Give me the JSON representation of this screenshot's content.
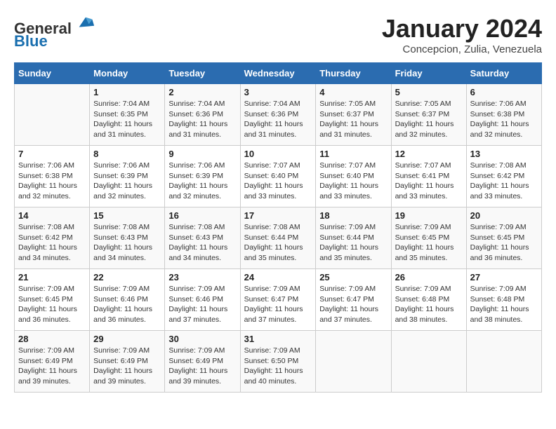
{
  "header": {
    "logo_general": "General",
    "logo_blue": "Blue",
    "month": "January 2024",
    "location": "Concepcion, Zulia, Venezuela"
  },
  "days_of_week": [
    "Sunday",
    "Monday",
    "Tuesday",
    "Wednesday",
    "Thursday",
    "Friday",
    "Saturday"
  ],
  "weeks": [
    [
      {
        "day": "",
        "sunrise": "",
        "sunset": "",
        "daylight": ""
      },
      {
        "day": "1",
        "sunrise": "Sunrise: 7:04 AM",
        "sunset": "Sunset: 6:35 PM",
        "daylight": "Daylight: 11 hours and 31 minutes."
      },
      {
        "day": "2",
        "sunrise": "Sunrise: 7:04 AM",
        "sunset": "Sunset: 6:36 PM",
        "daylight": "Daylight: 11 hours and 31 minutes."
      },
      {
        "day": "3",
        "sunrise": "Sunrise: 7:04 AM",
        "sunset": "Sunset: 6:36 PM",
        "daylight": "Daylight: 11 hours and 31 minutes."
      },
      {
        "day": "4",
        "sunrise": "Sunrise: 7:05 AM",
        "sunset": "Sunset: 6:37 PM",
        "daylight": "Daylight: 11 hours and 31 minutes."
      },
      {
        "day": "5",
        "sunrise": "Sunrise: 7:05 AM",
        "sunset": "Sunset: 6:37 PM",
        "daylight": "Daylight: 11 hours and 32 minutes."
      },
      {
        "day": "6",
        "sunrise": "Sunrise: 7:06 AM",
        "sunset": "Sunset: 6:38 PM",
        "daylight": "Daylight: 11 hours and 32 minutes."
      }
    ],
    [
      {
        "day": "7",
        "sunrise": "Sunrise: 7:06 AM",
        "sunset": "Sunset: 6:38 PM",
        "daylight": "Daylight: 11 hours and 32 minutes."
      },
      {
        "day": "8",
        "sunrise": "Sunrise: 7:06 AM",
        "sunset": "Sunset: 6:39 PM",
        "daylight": "Daylight: 11 hours and 32 minutes."
      },
      {
        "day": "9",
        "sunrise": "Sunrise: 7:06 AM",
        "sunset": "Sunset: 6:39 PM",
        "daylight": "Daylight: 11 hours and 32 minutes."
      },
      {
        "day": "10",
        "sunrise": "Sunrise: 7:07 AM",
        "sunset": "Sunset: 6:40 PM",
        "daylight": "Daylight: 11 hours and 33 minutes."
      },
      {
        "day": "11",
        "sunrise": "Sunrise: 7:07 AM",
        "sunset": "Sunset: 6:40 PM",
        "daylight": "Daylight: 11 hours and 33 minutes."
      },
      {
        "day": "12",
        "sunrise": "Sunrise: 7:07 AM",
        "sunset": "Sunset: 6:41 PM",
        "daylight": "Daylight: 11 hours and 33 minutes."
      },
      {
        "day": "13",
        "sunrise": "Sunrise: 7:08 AM",
        "sunset": "Sunset: 6:42 PM",
        "daylight": "Daylight: 11 hours and 33 minutes."
      }
    ],
    [
      {
        "day": "14",
        "sunrise": "Sunrise: 7:08 AM",
        "sunset": "Sunset: 6:42 PM",
        "daylight": "Daylight: 11 hours and 34 minutes."
      },
      {
        "day": "15",
        "sunrise": "Sunrise: 7:08 AM",
        "sunset": "Sunset: 6:43 PM",
        "daylight": "Daylight: 11 hours and 34 minutes."
      },
      {
        "day": "16",
        "sunrise": "Sunrise: 7:08 AM",
        "sunset": "Sunset: 6:43 PM",
        "daylight": "Daylight: 11 hours and 34 minutes."
      },
      {
        "day": "17",
        "sunrise": "Sunrise: 7:08 AM",
        "sunset": "Sunset: 6:44 PM",
        "daylight": "Daylight: 11 hours and 35 minutes."
      },
      {
        "day": "18",
        "sunrise": "Sunrise: 7:09 AM",
        "sunset": "Sunset: 6:44 PM",
        "daylight": "Daylight: 11 hours and 35 minutes."
      },
      {
        "day": "19",
        "sunrise": "Sunrise: 7:09 AM",
        "sunset": "Sunset: 6:45 PM",
        "daylight": "Daylight: 11 hours and 35 minutes."
      },
      {
        "day": "20",
        "sunrise": "Sunrise: 7:09 AM",
        "sunset": "Sunset: 6:45 PM",
        "daylight": "Daylight: 11 hours and 36 minutes."
      }
    ],
    [
      {
        "day": "21",
        "sunrise": "Sunrise: 7:09 AM",
        "sunset": "Sunset: 6:45 PM",
        "daylight": "Daylight: 11 hours and 36 minutes."
      },
      {
        "day": "22",
        "sunrise": "Sunrise: 7:09 AM",
        "sunset": "Sunset: 6:46 PM",
        "daylight": "Daylight: 11 hours and 36 minutes."
      },
      {
        "day": "23",
        "sunrise": "Sunrise: 7:09 AM",
        "sunset": "Sunset: 6:46 PM",
        "daylight": "Daylight: 11 hours and 37 minutes."
      },
      {
        "day": "24",
        "sunrise": "Sunrise: 7:09 AM",
        "sunset": "Sunset: 6:47 PM",
        "daylight": "Daylight: 11 hours and 37 minutes."
      },
      {
        "day": "25",
        "sunrise": "Sunrise: 7:09 AM",
        "sunset": "Sunset: 6:47 PM",
        "daylight": "Daylight: 11 hours and 37 minutes."
      },
      {
        "day": "26",
        "sunrise": "Sunrise: 7:09 AM",
        "sunset": "Sunset: 6:48 PM",
        "daylight": "Daylight: 11 hours and 38 minutes."
      },
      {
        "day": "27",
        "sunrise": "Sunrise: 7:09 AM",
        "sunset": "Sunset: 6:48 PM",
        "daylight": "Daylight: 11 hours and 38 minutes."
      }
    ],
    [
      {
        "day": "28",
        "sunrise": "Sunrise: 7:09 AM",
        "sunset": "Sunset: 6:49 PM",
        "daylight": "Daylight: 11 hours and 39 minutes."
      },
      {
        "day": "29",
        "sunrise": "Sunrise: 7:09 AM",
        "sunset": "Sunset: 6:49 PM",
        "daylight": "Daylight: 11 hours and 39 minutes."
      },
      {
        "day": "30",
        "sunrise": "Sunrise: 7:09 AM",
        "sunset": "Sunset: 6:49 PM",
        "daylight": "Daylight: 11 hours and 39 minutes."
      },
      {
        "day": "31",
        "sunrise": "Sunrise: 7:09 AM",
        "sunset": "Sunset: 6:50 PM",
        "daylight": "Daylight: 11 hours and 40 minutes."
      },
      {
        "day": "",
        "sunrise": "",
        "sunset": "",
        "daylight": ""
      },
      {
        "day": "",
        "sunrise": "",
        "sunset": "",
        "daylight": ""
      },
      {
        "day": "",
        "sunrise": "",
        "sunset": "",
        "daylight": ""
      }
    ]
  ]
}
